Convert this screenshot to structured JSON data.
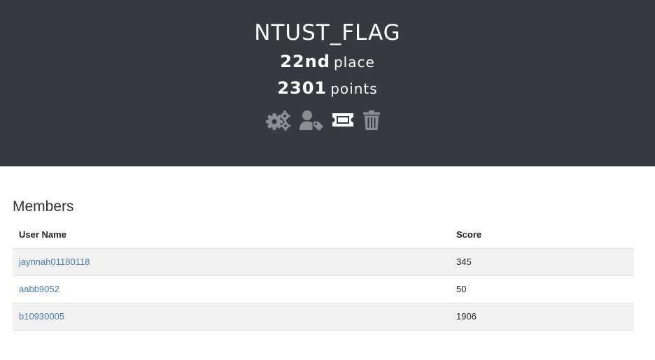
{
  "team": {
    "name": "NTUST_FLAG",
    "place_value": "22nd",
    "place_word": "place",
    "points_value": "2301",
    "points_word": "points"
  },
  "icons": [
    {
      "name": "settings-gears-icon"
    },
    {
      "name": "user-tag-icon"
    },
    {
      "name": "ticket-icon"
    },
    {
      "name": "trash-icon"
    }
  ],
  "members": {
    "title": "Members",
    "columns": {
      "user": "User Name",
      "score": "Score"
    },
    "rows": [
      {
        "user": "jaynnah01180118",
        "score": "345"
      },
      {
        "user": "aabb9052",
        "score": "50"
      },
      {
        "user": "b10930005",
        "score": "1906"
      }
    ]
  },
  "colors": {
    "header_bg": "#343a40",
    "icon_gray": "#8a8f94",
    "link": "#4a7ab5"
  }
}
